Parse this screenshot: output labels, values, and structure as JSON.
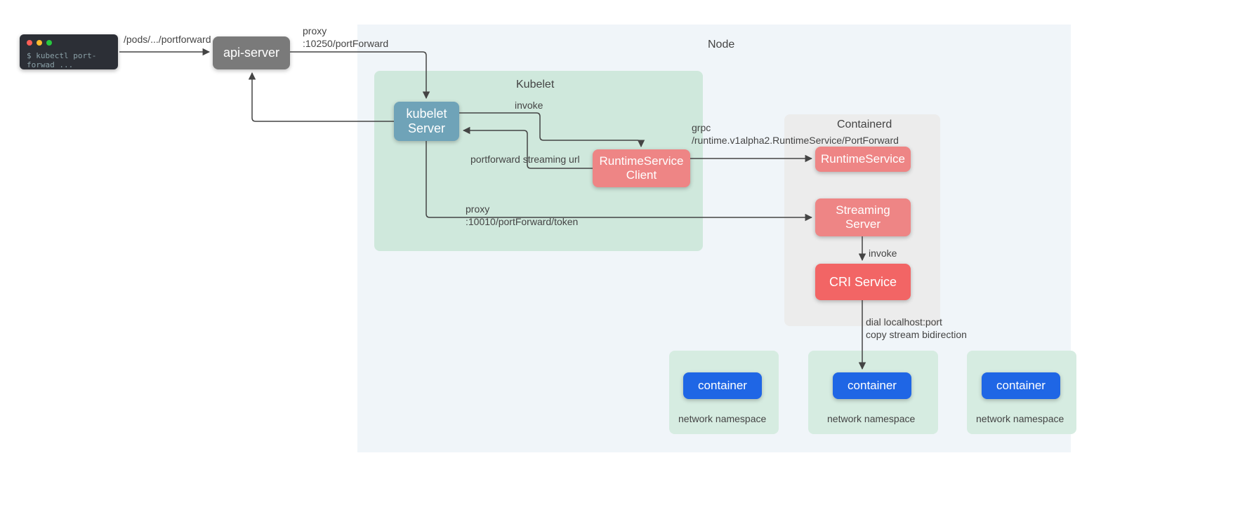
{
  "terminal": {
    "command": "$ kubectl port-forwad ..."
  },
  "boxes": {
    "api_server": "api-server",
    "kubelet_server": "kubelet\nServer",
    "runtime_client": "RuntimeService\nClient",
    "runtime_service": "RuntimeService",
    "streaming_server": "Streaming\nServer",
    "cri_service": "CRI Service",
    "container": "container"
  },
  "groups": {
    "node": "Node",
    "kubelet": "Kubelet",
    "containerd": "Containerd",
    "netns": "network namespace"
  },
  "edges": {
    "pods_path": "/pods/.../portforward",
    "proxy_10250": "proxy\n:10250/portForward",
    "invoke": "invoke",
    "pf_streaming_url": "portforward streaming url",
    "grpc": "grpc\n/runtime.v1alpha2.RuntimeService/PortForward",
    "proxy_10010": "proxy\n:10010/portForward/token",
    "dial": "dial localhost:port\ncopy stream bidirection"
  }
}
